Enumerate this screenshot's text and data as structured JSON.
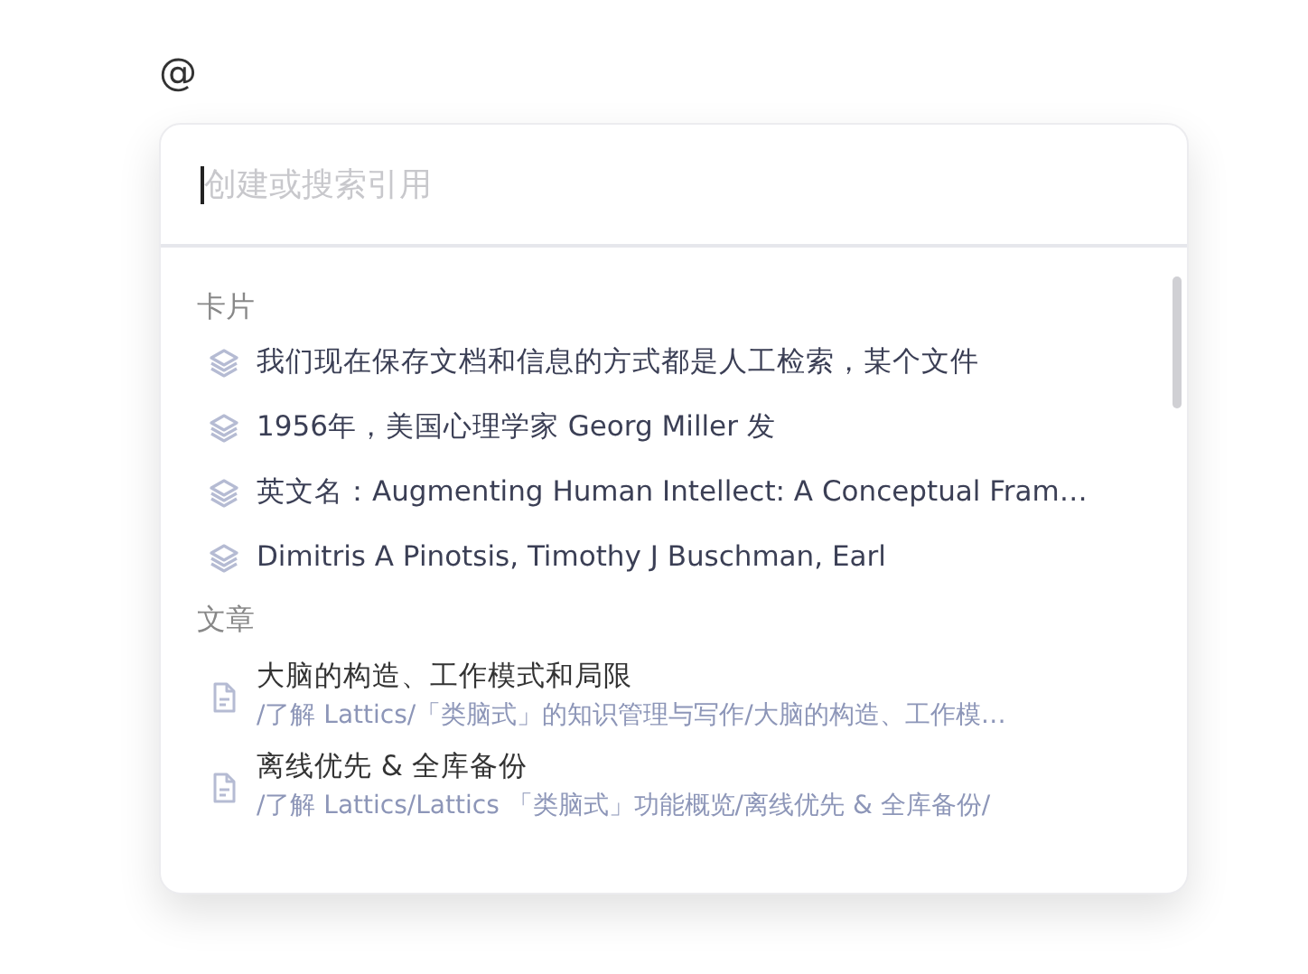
{
  "editor": {
    "text": "@"
  },
  "popup": {
    "search": {
      "placeholder": "创建或搜索引用"
    },
    "sections": [
      {
        "title": "卡片",
        "items": [
          {
            "kind": "card",
            "title": "我们现在保存文档和信息的方式都是人工检索，某个文件"
          },
          {
            "kind": "card",
            "title": "1956年，美国心理学家 Georg Miller 发"
          },
          {
            "kind": "card",
            "title": "英文名：Augmenting Human Intellect: A Conceptual Fram…"
          },
          {
            "kind": "card",
            "title": "Dimitris A Pinotsis, Timothy J Buschman, Earl"
          }
        ]
      },
      {
        "title": "文章",
        "items": [
          {
            "kind": "article",
            "title": "大脑的构造、工作模式和局限",
            "path": "/了解 Lattics/「类脑式」的知识管理与写作/大脑的构造、工作模…"
          },
          {
            "kind": "article",
            "title": "离线优先 & 全库备份",
            "path": "/了解 Lattics/Lattics 「类脑式」功能概览/离线优先 & 全库备份/"
          }
        ]
      }
    ]
  }
}
